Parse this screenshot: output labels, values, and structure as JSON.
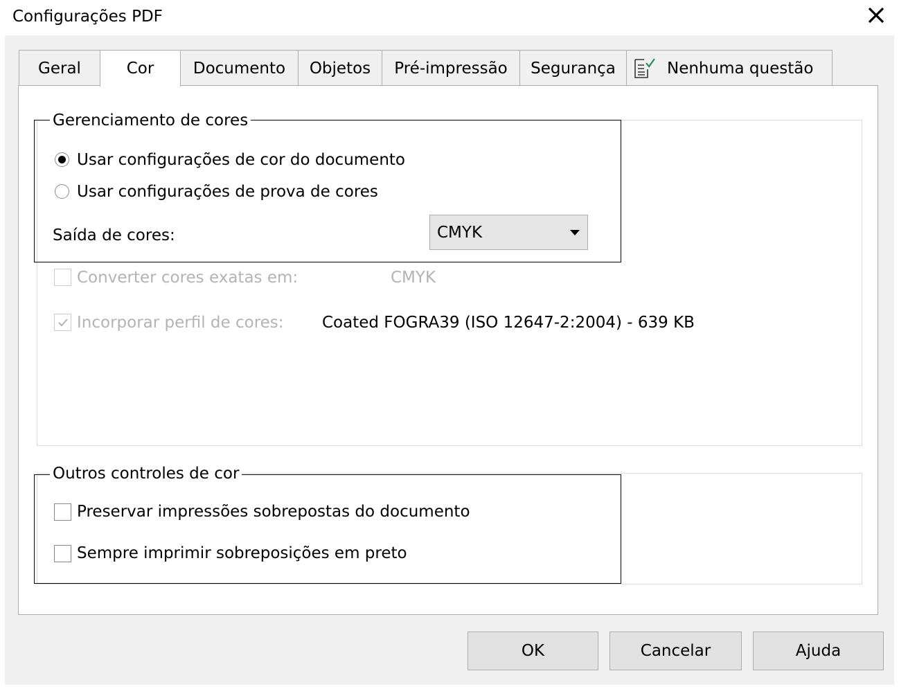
{
  "window": {
    "title": "Configurações PDF"
  },
  "tabs": [
    {
      "label": "Geral"
    },
    {
      "label": "Cor"
    },
    {
      "label": "Documento"
    },
    {
      "label": "Objetos"
    },
    {
      "label": "Pré-impressão"
    },
    {
      "label": "Segurança"
    },
    {
      "label": "Nenhuma questão",
      "icon": "checklist-icon"
    }
  ],
  "active_tab": "Cor",
  "color_management": {
    "legend": "Gerenciamento de cores",
    "radio_document": {
      "label": "Usar configurações de cor do documento",
      "checked": true
    },
    "radio_proof": {
      "label": "Usar configurações de prova de cores",
      "checked": false
    },
    "output_label": "Saída de cores:",
    "output_value": "CMYK",
    "convert_spot": {
      "label": "Converter cores exatas em:",
      "value": "CMYK",
      "checked": false,
      "enabled": false
    },
    "embed_profile": {
      "label": "Incorporar perfil de cores:",
      "value": "Coated FOGRA39 (ISO 12647-2:2004) - 639 KB",
      "checked": true,
      "enabled": false
    }
  },
  "other_controls": {
    "legend": "Outros controles de cor",
    "preserve_overprints": {
      "label": "Preservar impressões sobrepostas do documento",
      "checked": false
    },
    "always_overprint_black": {
      "label": "Sempre imprimir sobreposições em preto",
      "checked": false
    }
  },
  "buttons": {
    "ok": "OK",
    "cancel": "Cancelar",
    "help": "Ajuda"
  },
  "colors": {
    "window_bg": "#f0f0f0",
    "panel_bg": "#ffffff",
    "border": "#adadad",
    "disabled_text": "#b3b3b3",
    "check_green": "#2e8b57"
  }
}
